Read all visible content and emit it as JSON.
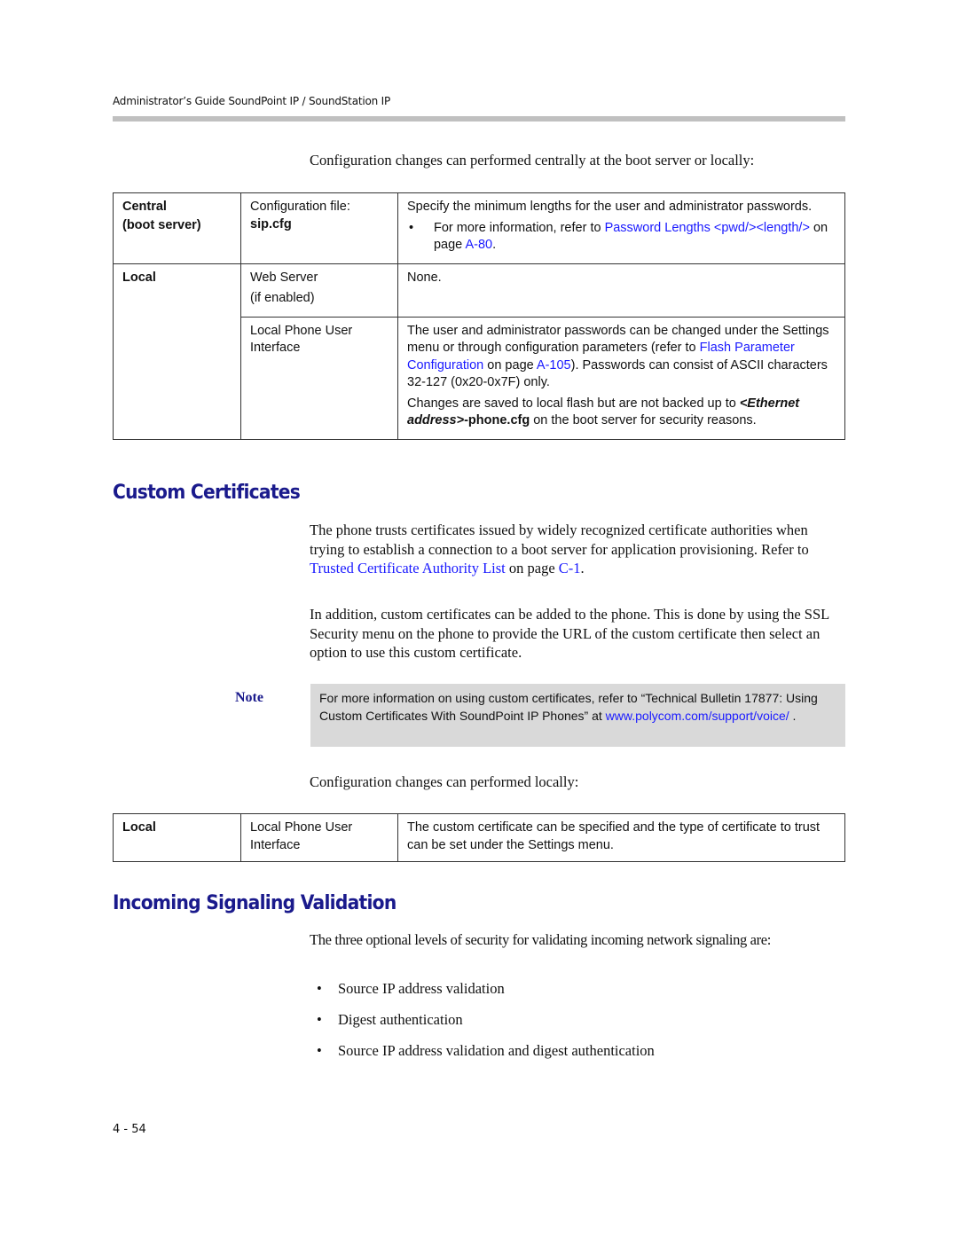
{
  "header": {
    "title": "Administrator’s Guide SoundPoint IP / SoundStation IP"
  },
  "intro1": "Configuration changes can performed centrally at the boot server or locally:",
  "table1": {
    "central": {
      "label_line1": "Central",
      "label_line2": "(boot server)",
      "method_line1": "Configuration file:",
      "method_file": "sip.cfg",
      "desc": "Specify the minimum lengths for the user and administrator passwords.",
      "bullet_prefix": "For more information, refer to ",
      "bullet_link": "Password Lengths <pwd/><length/>",
      "bullet_mid": " on page ",
      "bullet_page": "A-80",
      "bullet_suffix": "."
    },
    "local": {
      "label": "Local",
      "web_method_line1": "Web Server",
      "web_method_line2": "(if enabled)",
      "web_desc": "None.",
      "ui_method_line1": "Local Phone User",
      "ui_method_line2": "Interface",
      "ui_desc_part1": "The user and administrator passwords can be changed under the Settings menu or through configuration parameters (refer to ",
      "ui_desc_link": "Flash Parameter Configuration",
      "ui_desc_mid": " on page ",
      "ui_desc_page": "A-105",
      "ui_desc_part2": "). Passwords can consist of ASCII characters 32-127 (0x20-0x7F) only.",
      "ui_desc2_part1": "Changes are saved to local flash but are not backed up to ",
      "ui_desc2_bi": "<Ethernet address>",
      "ui_desc2_b": "-phone.cfg",
      "ui_desc2_part2": " on the boot server for security reasons."
    }
  },
  "section1": {
    "title": "Custom Certificates",
    "para1_part1": "The phone trusts certificates issued by widely recognized certificate authorities when trying to establish a connection to a boot server for application provisioning. Refer to ",
    "para1_link": "Trusted Certificate Authority List",
    "para1_mid": " on page ",
    "para1_page": "C-1",
    "para1_end": ".",
    "para2": "In addition, custom certificates can be added to the phone. This is done by using the SSL Security menu on the phone to provide the URL of the custom certificate then select an option to use this custom certificate.",
    "note_label": "Note",
    "note_text": "For more information on using custom certificates, refer to “Technical Bulletin 17877: Using Custom Certificates With SoundPoint IP Phones” at ",
    "note_link": "www.polycom.com/support/voice/",
    "note_end": " .",
    "intro2": "Configuration changes can performed locally:"
  },
  "table2": {
    "label": "Local",
    "method_line1": "Local Phone User",
    "method_line2": "Interface",
    "desc": "The custom certificate can be specified and the type of certificate to trust can be set under the Settings menu."
  },
  "section2": {
    "title": "Incoming Signaling Validation",
    "para": "The three optional levels of security for validating incoming network signaling are:",
    "bullets": [
      "Source IP address validation",
      "Digest authentication",
      "Source IP address validation and digest authentication"
    ]
  },
  "footer": {
    "page_number": "4 - 54"
  },
  "colors": {
    "heading": "#1a1a8c",
    "link": "#1a1aff",
    "note_bg": "#d9d9d9",
    "header_bar": "#c0c0c0"
  }
}
